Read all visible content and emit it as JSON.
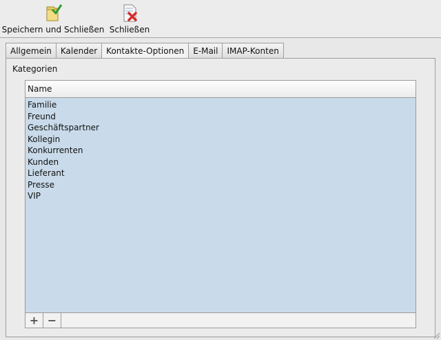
{
  "toolbar": {
    "save_close_label": "Speichern und Schließen",
    "close_label": "Schließen"
  },
  "tabs": [
    {
      "label": "Allgemein"
    },
    {
      "label": "Kalender"
    },
    {
      "label": "Kontakte-Optionen",
      "active": true
    },
    {
      "label": "E-Mail"
    },
    {
      "label": "IMAP-Konten"
    }
  ],
  "section": {
    "label": "Kategorien"
  },
  "table": {
    "column_header": "Name",
    "rows": [
      "Familie",
      "Freund",
      "Geschäftspartner",
      "Kollegin",
      "Konkurrenten",
      "Kunden",
      "Lieferant",
      "Presse",
      "VIP"
    ],
    "add_symbol": "+",
    "remove_symbol": "−"
  },
  "colors": {
    "selection_bg": "#c9dbea",
    "window_bg": "#e8e8e8"
  },
  "icons": {
    "save_close": "folder-check-icon",
    "close": "document-x-icon"
  }
}
